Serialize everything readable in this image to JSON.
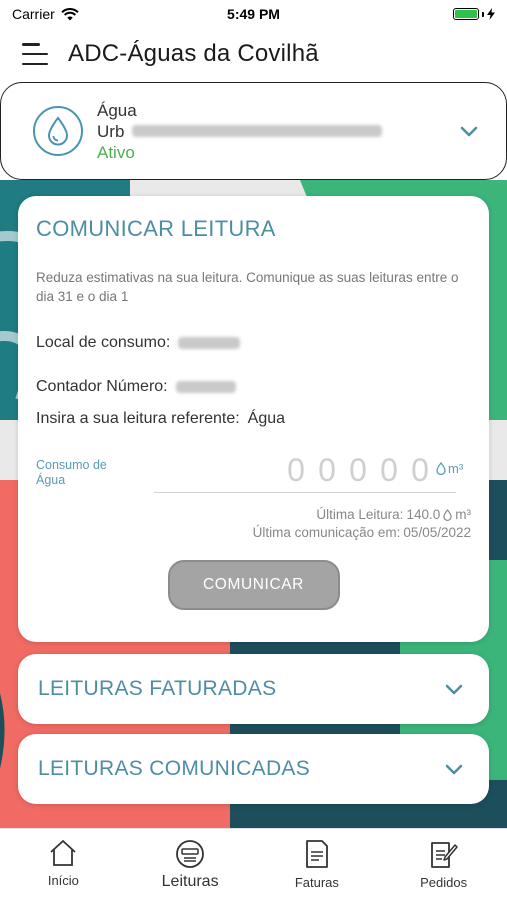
{
  "status_bar": {
    "carrier": "Carrier",
    "time": "5:49 PM",
    "wifi_icon": "wifi-icon",
    "battery_icon": "battery-icon"
  },
  "header": {
    "title": "ADC-Águas da Covilhã",
    "menu_icon": "hamburger-menu-icon"
  },
  "account": {
    "service": "Água",
    "address_prefix": "Urb",
    "status": "Ativo",
    "icon": "water-drop-icon",
    "toggle_icon": "chevron-down-icon"
  },
  "reading_form": {
    "title": "COMUNICAR LEITURA",
    "description": "Reduza estimativas na sua leitura. Comunique as suas leituras entre o dia 31 e o dia 1",
    "local_label": "Local de consumo:",
    "contador_label": "Contador Número:",
    "insira_label": "Insira a sua leitura referente:",
    "insira_value": "Água",
    "consumo_label": "Consumo de Água",
    "digit_placeholders": [
      "0",
      "0",
      "0",
      "0",
      "0"
    ],
    "unit": "m³",
    "last_reading_label": "Última Leitura:",
    "last_reading_value": "140.0",
    "last_reading_unit": "m³",
    "last_communication_label": "Última comunicação em:",
    "last_communication_date": "05/05/2022",
    "submit_label": "COMUNICAR"
  },
  "sections": {
    "faturadas": "LEITURAS FATURADAS",
    "comunicadas": "LEITURAS COMUNICADAS"
  },
  "tabs": [
    {
      "label": "Início",
      "icon": "home-icon",
      "active": false
    },
    {
      "label": "Leituras",
      "icon": "readings-icon",
      "active": true
    },
    {
      "label": "Faturas",
      "icon": "invoice-icon",
      "active": false
    },
    {
      "label": "Pedidos",
      "icon": "requests-icon",
      "active": false
    }
  ],
  "colors": {
    "accent": "#4d8ea5",
    "active_status": "#4caf50",
    "button": "#a4a4a4",
    "bg_green": "#3bb57a",
    "bg_coral": "#f06b63",
    "bg_teal": "#1d4e5c"
  }
}
